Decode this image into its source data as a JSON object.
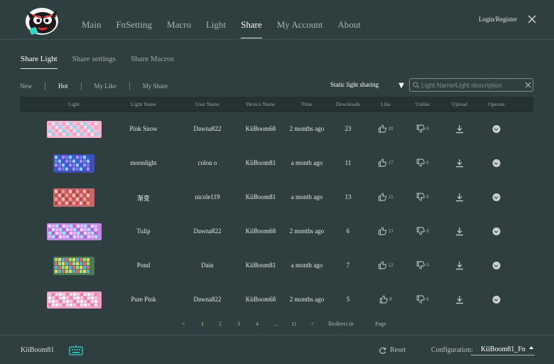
{
  "nav": {
    "items": [
      {
        "label": "Main",
        "active": false
      },
      {
        "label": "FnSetting",
        "active": false
      },
      {
        "label": "Macro",
        "active": false
      },
      {
        "label": "Light",
        "active": false
      },
      {
        "label": "Share",
        "active": true
      },
      {
        "label": "My Account",
        "active": false
      },
      {
        "label": "About",
        "active": false
      }
    ],
    "login_label": "Login/Register",
    "close_icon": "close-icon"
  },
  "subtabs": [
    {
      "label": "Share Light",
      "active": true
    },
    {
      "label": "Share settings",
      "active": false
    },
    {
      "label": "Share Macros",
      "active": false
    }
  ],
  "filters": [
    {
      "label": "New",
      "active": false
    },
    {
      "label": "Hot",
      "active": true
    },
    {
      "label": "My Like",
      "active": false
    },
    {
      "label": "My Share",
      "active": false
    }
  ],
  "dropdown": {
    "value": "Static light sharing",
    "arrow": "▼"
  },
  "search": {
    "placeholder": "Light Name/Light description"
  },
  "table": {
    "headers": [
      "Light",
      "Light Name",
      "User Name",
      "Device Name",
      "Time",
      "Downloads",
      "Like",
      "Unlike",
      "Upload",
      "Operate"
    ],
    "rows": [
      {
        "light_name": "Pink Snow",
        "user": "Dawna822",
        "device": "KiiBoom68",
        "time": "2 months ago",
        "downloads": "23",
        "likes": "20",
        "unlikes": "0",
        "thumb": "pink"
      },
      {
        "light_name": "moonlight",
        "user": "colon o",
        "device": "KiiBoom81",
        "time": "a month ago",
        "downloads": "11",
        "likes": "17",
        "unlikes": "0",
        "thumb": "blue"
      },
      {
        "light_name": "渐变",
        "user": "nicole119",
        "device": "KiiBoom81",
        "time": "a month ago",
        "downloads": "13",
        "likes": "15",
        "unlikes": "0",
        "thumb": "red"
      },
      {
        "light_name": "Tulip",
        "user": "Dawna822",
        "device": "KiiBoom68",
        "time": "2 months ago",
        "downloads": "6",
        "likes": "13",
        "unlikes": "0",
        "thumb": "violet"
      },
      {
        "light_name": "Pond",
        "user": "Dain",
        "device": "KiiBoom81",
        "time": "a month ago",
        "downloads": "7",
        "likes": "12",
        "unlikes": "0",
        "thumb": "green"
      },
      {
        "light_name": "Pure Pink",
        "user": "Dawna822",
        "device": "KiiBoom68",
        "time": "2 months ago",
        "downloads": "5",
        "likes": "8",
        "unlikes": "0",
        "thumb": "pinkwhite"
      }
    ]
  },
  "pagination": {
    "prev": "<",
    "pages": [
      "1",
      "2",
      "3",
      "4",
      "...",
      "11"
    ],
    "current": "1",
    "next": ">",
    "redirect_label": "Redirect to",
    "page_label": "Page"
  },
  "footer": {
    "device": "KiiBoom81",
    "reset_label": "Reset",
    "config_label": "Configuration:",
    "config_value": "KiiBoom81_Fn"
  },
  "colors": {
    "background": "#2f3e3e",
    "header_bg": "#233131",
    "accent": "#2fd6c6",
    "current_page": "#e8d56a"
  }
}
